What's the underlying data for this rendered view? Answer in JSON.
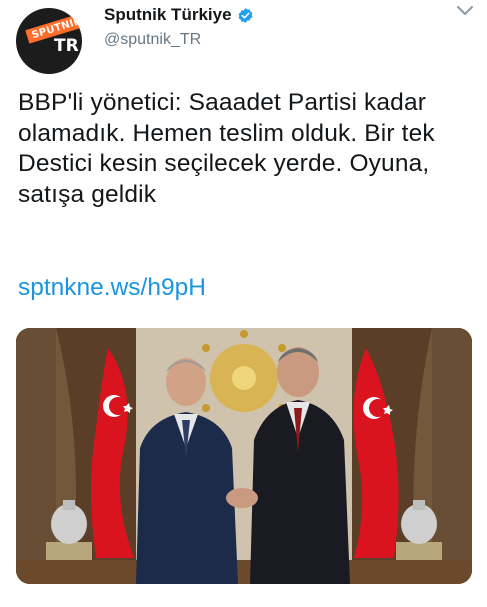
{
  "account": {
    "display_name": "Sputnik Türkiye",
    "handle": "@sputnik_TR",
    "verified": true,
    "avatar_brand_word": "SPUTNIK",
    "avatar_region": "TR"
  },
  "tweet": {
    "text": "BBP'li yönetici: Saaadet Partisi kadar olamadık. Hemen teslim olduk. Bir tek Destici kesin seçilecek yerde. Oyuna, satışa geldik",
    "link": "sptnkne.ws/h9pH"
  },
  "icons": {
    "verified": "verified-badge-icon",
    "menu": "chevron-down-icon"
  },
  "colors": {
    "brand_orange": "#ff6d2b",
    "verified_blue": "#1da1f2",
    "link_blue": "#1b95e0",
    "flag_red": "#d9141e"
  }
}
